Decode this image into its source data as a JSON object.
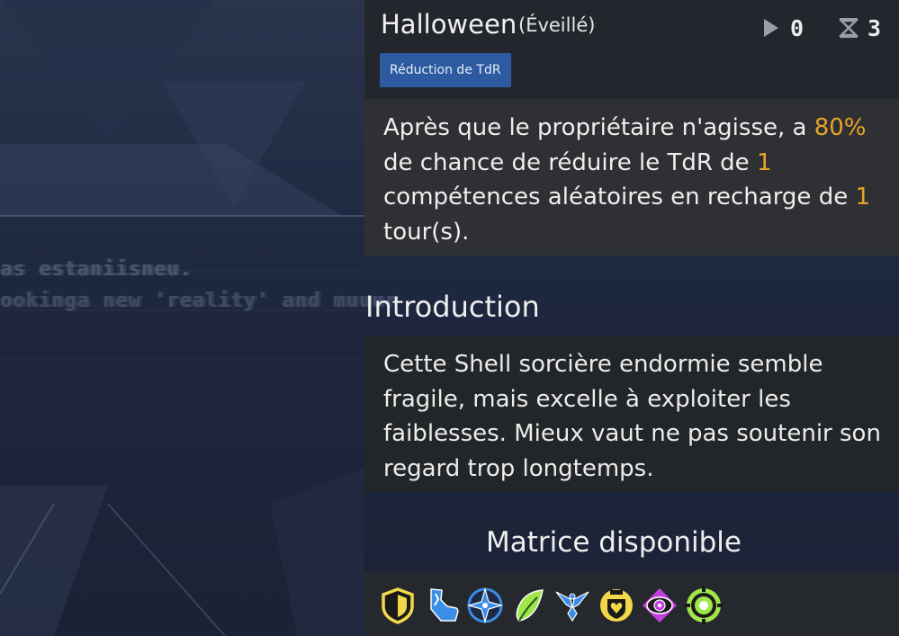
{
  "skill": {
    "name": "Halloween",
    "state": "(Éveillé)",
    "tag": "Réduction de TdR",
    "cost": "0",
    "cooldown": "3",
    "description": {
      "p1": "Après que le propriétaire n'agisse, a ",
      "chance": "80%",
      "p2": " de chance de réduire le TdR de ",
      "count": "1",
      "p3": " compétences aléatoires en recharge de ",
      "turns": "1",
      "p4": " tour(s)."
    }
  },
  "background_text": {
    "line1": "as estaniisneu.",
    "line2": "ookinga new 'reality' and muuur"
  },
  "introduction": {
    "title": "Introduction",
    "text": "Cette Shell sorcière endormie semble fragile, mais excelle à exploiter les faiblesses. Mieux vaut ne pas soutenir son regard trop longtemps."
  },
  "matrix": {
    "title": "Matrice disponible",
    "icons": [
      {
        "name": "shield-matrix-icon",
        "color": "#f1d84a"
      },
      {
        "name": "boot-matrix-icon",
        "color": "#3a8de8"
      },
      {
        "name": "compass-star-matrix-icon",
        "color": "#3a8de8"
      },
      {
        "name": "leaf-matrix-icon",
        "color": "#9ee64a"
      },
      {
        "name": "wings-matrix-icon",
        "color": "#3a8de8"
      },
      {
        "name": "heart-shield-matrix-icon",
        "color": "#f1d84a"
      },
      {
        "name": "eye-matrix-icon",
        "color": "#c23ee0"
      },
      {
        "name": "target-matrix-icon",
        "color": "#9ee64a"
      }
    ]
  },
  "colors": {
    "highlight": "#e6a528",
    "tag_bg": "#2d5aa0"
  }
}
